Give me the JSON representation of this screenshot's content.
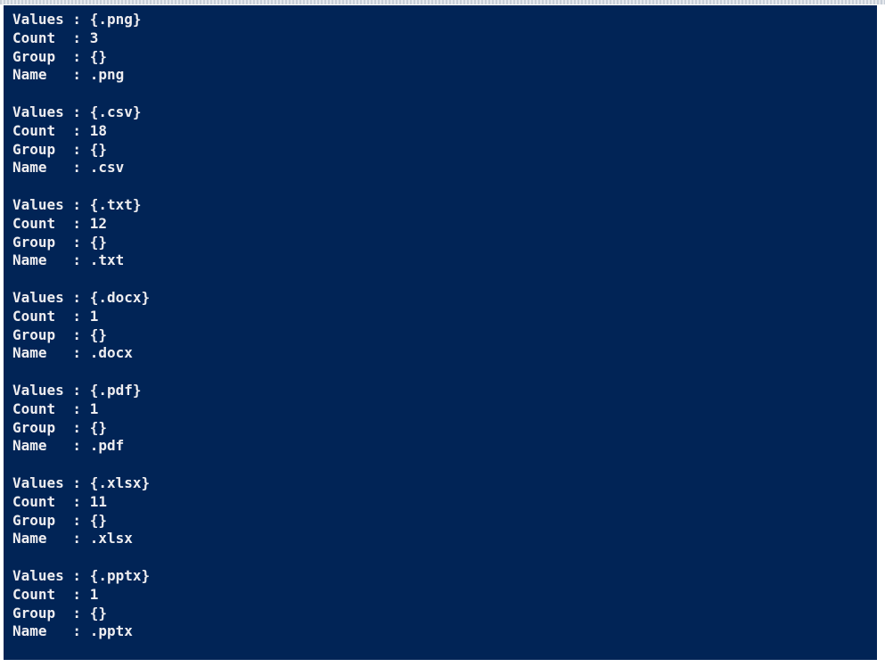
{
  "console": {
    "background": "#012456",
    "foreground": "#eeedf0",
    "groups": [
      {
        "values": "{.png}",
        "count": "3",
        "group": "{}",
        "name": ".png"
      },
      {
        "values": "{.csv}",
        "count": "18",
        "group": "{}",
        "name": ".csv"
      },
      {
        "values": "{.txt}",
        "count": "12",
        "group": "{}",
        "name": ".txt"
      },
      {
        "values": "{.docx}",
        "count": "1",
        "group": "{}",
        "name": ".docx"
      },
      {
        "values": "{.pdf}",
        "count": "1",
        "group": "{}",
        "name": ".pdf"
      },
      {
        "values": "{.xlsx}",
        "count": "11",
        "group": "{}",
        "name": ".xlsx"
      },
      {
        "values": "{.pptx}",
        "count": "1",
        "group": "{}",
        "name": ".pptx"
      }
    ],
    "labels": {
      "values": "Values : ",
      "count": "Count  : ",
      "group": "Group  : ",
      "name": "Name   : "
    }
  }
}
